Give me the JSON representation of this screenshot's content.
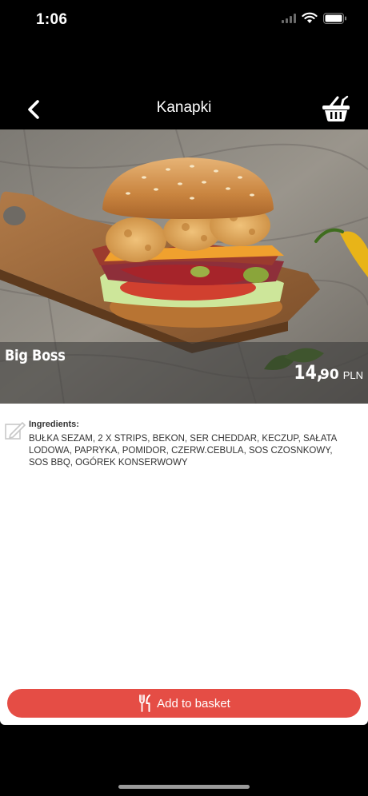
{
  "status_bar": {
    "time": "1:06",
    "icons": [
      "signal-icon",
      "wifi-icon",
      "battery-icon"
    ]
  },
  "nav": {
    "title": "Kanapki",
    "back_icon": "chevron-left-icon",
    "basket_icon": "basket-icon"
  },
  "product": {
    "name": "Big Boss",
    "price_integer": "14,",
    "price_decimal": "90",
    "currency": "PLN",
    "image": "burger-photo"
  },
  "ingredients": {
    "heading": "Ingredients:",
    "text": "BUŁKA SEZAM, 2 X STRIPS, BEKON, SER CHEDDAR, KECZUP, SAŁATA LODOWA, PAPRYKA, POMIDOR, CZERW.CEBULA, SOS CZOSNKOWY, SOS BBQ, OGÓREK KONSERWOWY",
    "icon": "edit-note-icon"
  },
  "actions": {
    "add_to_basket": "Add to basket",
    "add_icon": "cutlery-icon"
  },
  "colors": {
    "accent": "#e54d45",
    "background": "#000000",
    "panel": "#ffffff"
  }
}
